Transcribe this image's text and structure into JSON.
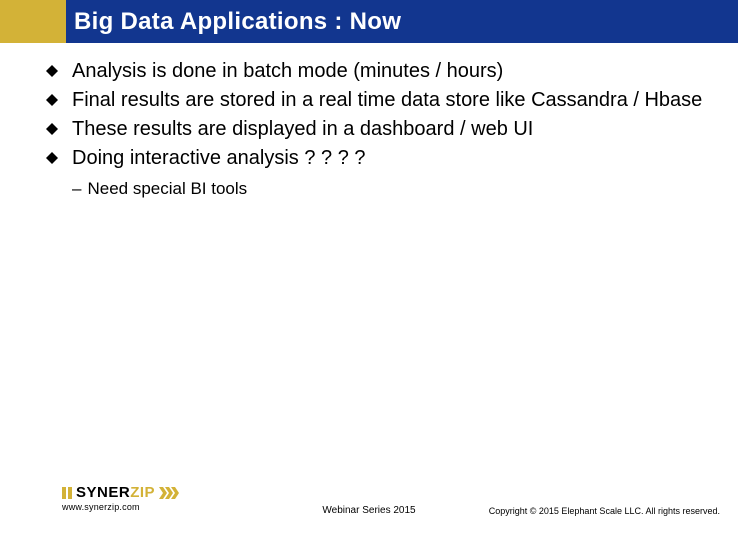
{
  "header": {
    "title": "Big Data Applications : Now"
  },
  "bullets": {
    "items": [
      "Analysis is done in batch mode (minutes / hours)",
      "Final results are stored in a real time data store like Cassandra / Hbase",
      "These results are displayed in a dashboard / web UI",
      "Doing interactive analysis ? ? ? ?"
    ],
    "sub": "Need special BI tools"
  },
  "logo": {
    "brand_left": "SYNER",
    "brand_right": "ZIP",
    "url": "www.synerzip.com"
  },
  "footer": {
    "center": "Webinar Series 2015",
    "right": "Copyright © 2015 Elephant Scale LLC.  All rights reserved."
  }
}
